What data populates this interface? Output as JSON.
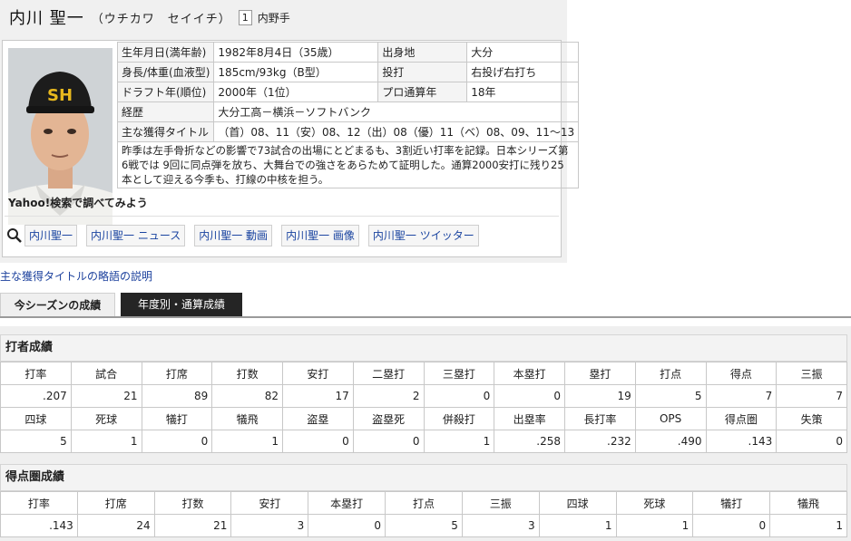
{
  "player": {
    "name": "内川 聖一",
    "kana": "（ウチカワ　セイイチ）",
    "number": "1",
    "position": "内野手"
  },
  "info": {
    "birth_label": "生年月日(満年齢)",
    "birth_value": "1982年8月4日（35歳）",
    "hometown_label": "出身地",
    "hometown_value": "大分",
    "body_label": "身長/体重(血液型)",
    "body_value": "185cm/93kg（B型）",
    "throwbat_label": "投打",
    "throwbat_value": "右投げ右打ち",
    "draft_label": "ドラフト年(順位)",
    "draft_value": "2000年（1位）",
    "years_label": "プロ通算年",
    "years_value": "18年",
    "career_label": "経歴",
    "career_value": "大分工高－横浜－ソフトバンク",
    "titles_label": "主な獲得タイトル",
    "titles_value": "（首）08、11（安）08、12（出）08（優）11（ベ）08、09、11～13",
    "description": "昨季は左手骨折などの影響で73試合の出場にとどまるも、3割近い打率を記録。日本シリーズ第6戦では 9回に同点弾を放ち、大舞台での強さをあらためて証明した。通算2000安打に残り25本として迎える今季も、打線の中核を担う。"
  },
  "yahoo": {
    "title": "Yahoo!検索で調べてみよう",
    "keywords": [
      "内川聖一",
      "内川聖一 ニュース",
      "内川聖一 動画",
      "内川聖一 画像",
      "内川聖一 ツイッター"
    ]
  },
  "title_link": "主な獲得タイトルの略語の説明",
  "tabs": [
    "今シーズンの成績",
    "年度別・通算成績"
  ],
  "batting": {
    "title": "打者成績",
    "headers1": [
      "打率",
      "試合",
      "打席",
      "打数",
      "安打",
      "二塁打",
      "三塁打",
      "本塁打",
      "塁打",
      "打点",
      "得点",
      "三振"
    ],
    "values1": [
      ".207",
      "21",
      "89",
      "82",
      "17",
      "2",
      "0",
      "0",
      "19",
      "5",
      "7",
      "7"
    ],
    "headers2": [
      "四球",
      "死球",
      "犠打",
      "犠飛",
      "盗塁",
      "盗塁死",
      "併殺打",
      "出塁率",
      "長打率",
      "OPS",
      "得点圏",
      "失策"
    ],
    "values2": [
      "5",
      "1",
      "0",
      "1",
      "0",
      "0",
      "1",
      ".258",
      ".232",
      ".490",
      ".143",
      "0"
    ]
  },
  "risp": {
    "title": "得点圏成績",
    "headers": [
      "打率",
      "打席",
      "打数",
      "安打",
      "本塁打",
      "打点",
      "三振",
      "四球",
      "死球",
      "犠打",
      "犠飛"
    ],
    "values": [
      ".143",
      "24",
      "21",
      "3",
      "0",
      "5",
      "3",
      "1",
      "1",
      "0",
      "1"
    ]
  },
  "colors": {
    "link": "#1a44a0",
    "active_tab": "#252525",
    "cap": "#1c1c1c",
    "cap_logo": "#e7b81e"
  }
}
